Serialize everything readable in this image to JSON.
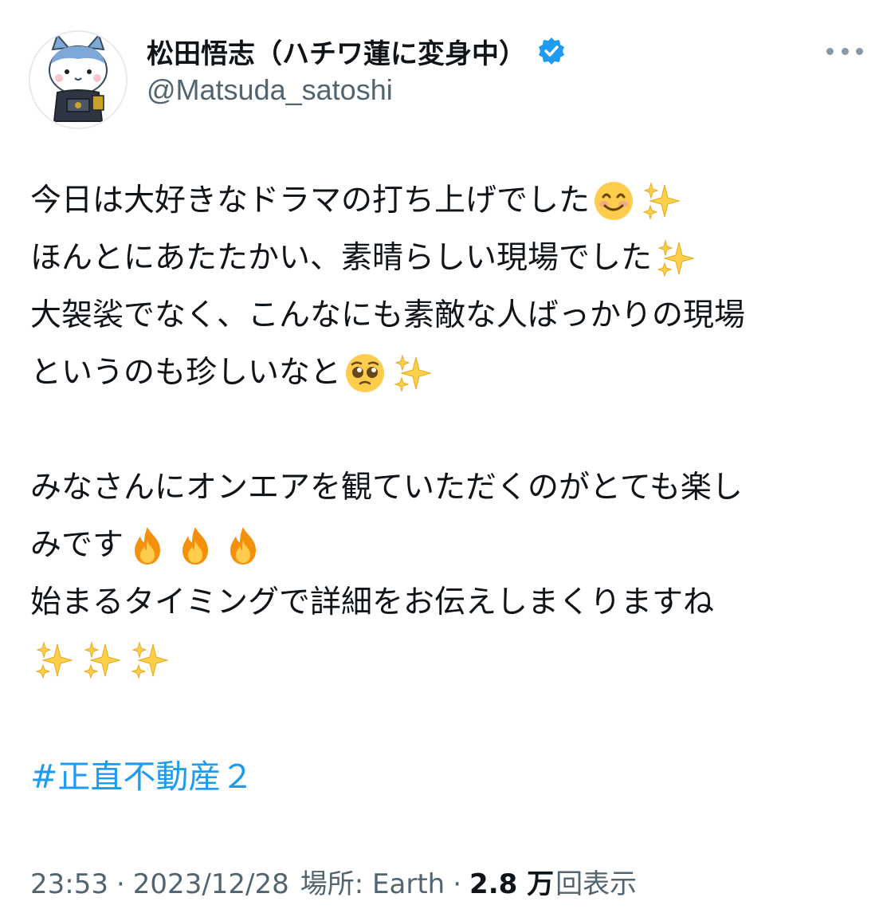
{
  "user": {
    "display_name": "松田悟志（ハチワ蓮に変身中）",
    "handle": "@Matsuda_satoshi",
    "verified": true,
    "verified_color": "#1d9bf0"
  },
  "tweet": {
    "lines": [
      "今日は大好きなドラマの打ち上げでした",
      "ほんとにあたたかい、素晴らしい現場でした",
      "大袈裟でなく、こんなにも素敵な人ばっかりの現場",
      "というのも珍しいなと",
      "みなさんにオンエアを観ていただくのがとても楽し",
      "みです",
      "始まるタイミングで詳細をお伝えしまくりますね"
    ],
    "emojis": {
      "smile": "😊",
      "sparkles": "✨",
      "pleading": "🥺",
      "fire": "🔥"
    },
    "hashtag": "#正直不動産２",
    "hashtag_color": "#1d9bf0"
  },
  "meta": {
    "time": "23:53",
    "separator": "·",
    "date": "2023/12/28",
    "location_label": "場所: Earth",
    "views_count": "2.8 万",
    "views_label": "回表示"
  },
  "icons": {
    "more": "more-horizontal-icon",
    "verified": "verified-badge-icon"
  }
}
